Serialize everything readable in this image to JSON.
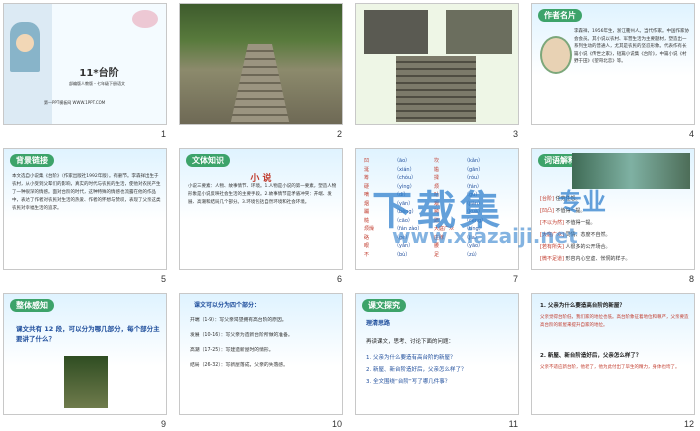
{
  "slides": [
    {
      "n": "1",
      "title": "11*台阶",
      "sub": "部编版人教版・七年级下册语文",
      "site": "第一PPT模板网 WWW.1PPT.COM"
    },
    {
      "n": "2"
    },
    {
      "n": "3"
    },
    {
      "n": "4",
      "head": "作者名片",
      "text": "李森祥，1956年生，浙江衢州人。当代作家。中国作家协会会员。其小说以农村、军营生活为主要题材，塑造出一系列生动的普通人，尤其是农民的坚忍形象。代表作有长篇小说《传世之家》，短篇小说集《台阶》，中篇小说《村野于田》《望哥北恋》等。"
    },
    {
      "n": "5",
      "head": "背景链接",
      "text": "本文选自小说集《台阶》（作家出版社1992年版）。有删节。李森祥出生于农村，从小受到父辈们的影响，真实的时代与农民的生活，使他对农民产生了一种很深的情感。面对台阶的时代，这种特殊的情感也流露在他的作品中，表达了作者对农民对生活的热爱、作者的怀想与赞叹，表现了父亲这类农民对幸福生活的追求。"
    },
    {
      "n": "6",
      "head": "文体知识",
      "subhead": "小 说",
      "text": "小说三要素：人物、故事情节、环境。1.人物是小说的第一要素，塑造人物形象是小说反映社会生活的主要手段。2.故事情节是矛盾冲突：开端、发展、高潮和结局几个部分。3.环境包括自然环境和社会环境。"
    },
    {
      "n": "7",
      "rows": [
        [
          "凹",
          "āo",
          "坎",
          "kǎn"
        ],
        [
          "涎",
          "xián",
          "尴",
          "gān"
        ],
        [
          "筹",
          "chóu",
          "揉",
          "róu"
        ],
        [
          "硬",
          "yìng",
          "烦",
          "fán"
        ],
        [
          "嘀",
          "dí",
          "咕",
          "gu"
        ],
        [
          "烟",
          "yān",
          "艰",
          "jiān"
        ],
        [
          "蹦",
          "bèng",
          "跨",
          "kuà"
        ],
        [
          "糙",
          "cāo",
          "蹭",
          "cèng"
        ],
        [
          "烦燥",
          "fán zào",
          "大庭广众",
          "tíng"
        ],
        [
          "硌",
          "gè",
          "庄稼",
          "jia"
        ],
        [
          "眼",
          "yǎn",
          "腰",
          "yāo"
        ],
        [
          "不",
          "bù",
          "足",
          "zú"
        ]
      ]
    },
    {
      "n": "8",
      "head": "词语解释",
      "lines": [
        "[台阶]",
        "[凹凸]",
        "[不以为然]",
        "[大庭广众]",
        "[若有所失]",
        "[微不足道]"
      ],
      "defs": [
        "任劳任怨。",
        "不值得一提。",
        "不值得一提。",
        "同情、态度不自然。",
        "人很多的公开场合。",
        "形容内心空虚、怅惘的样子。"
      ]
    },
    {
      "n": "9",
      "head": "整体感知",
      "question": "课文共有 12 段，可以分为哪几部分，每个部分主要讲了什么？"
    },
    {
      "n": "10",
      "head": "课文可以分为四个部分：",
      "parts": [
        "开端（1-9）：写父亲渴望拥有高台阶的原因。",
        "发展（10-16）：写父亲为造新台阶所做的准备。",
        "高潮（17-25）：写建造新屋时的情形。",
        "结局（26-32）：写新屋落成，父亲的失落感。"
      ]
    },
    {
      "n": "11",
      "head": "课文探究",
      "sub": "理清思路",
      "lead": "再读课文，思考、讨论下面的问题：",
      "qs": [
        "1. 父亲为什么要造有高台阶的新屋？",
        "2. 新屋、新台阶造好后，父亲怎么样了？",
        "3. 全文围绕“台阶”写了哪几件事？"
      ]
    },
    {
      "n": "12",
      "q1": "1. 父亲为什么要造高台阶的新屋？",
      "a1": "父亲觉得台阶低，我们家的地位也低。高台阶象征着地位和尊严，父亲要造高台阶的新屋来提升自家的地位。",
      "q2": "2. 新屋、新台阶造好后，父亲怎么样了？",
      "a2": "父亲不适应新台阶，他老了，他为此付出了毕生的精力，身体也垮了。"
    }
  ],
  "watermark": {
    "main": "下载集",
    "side": "专业",
    "url": "www.xiazaiji.net"
  }
}
